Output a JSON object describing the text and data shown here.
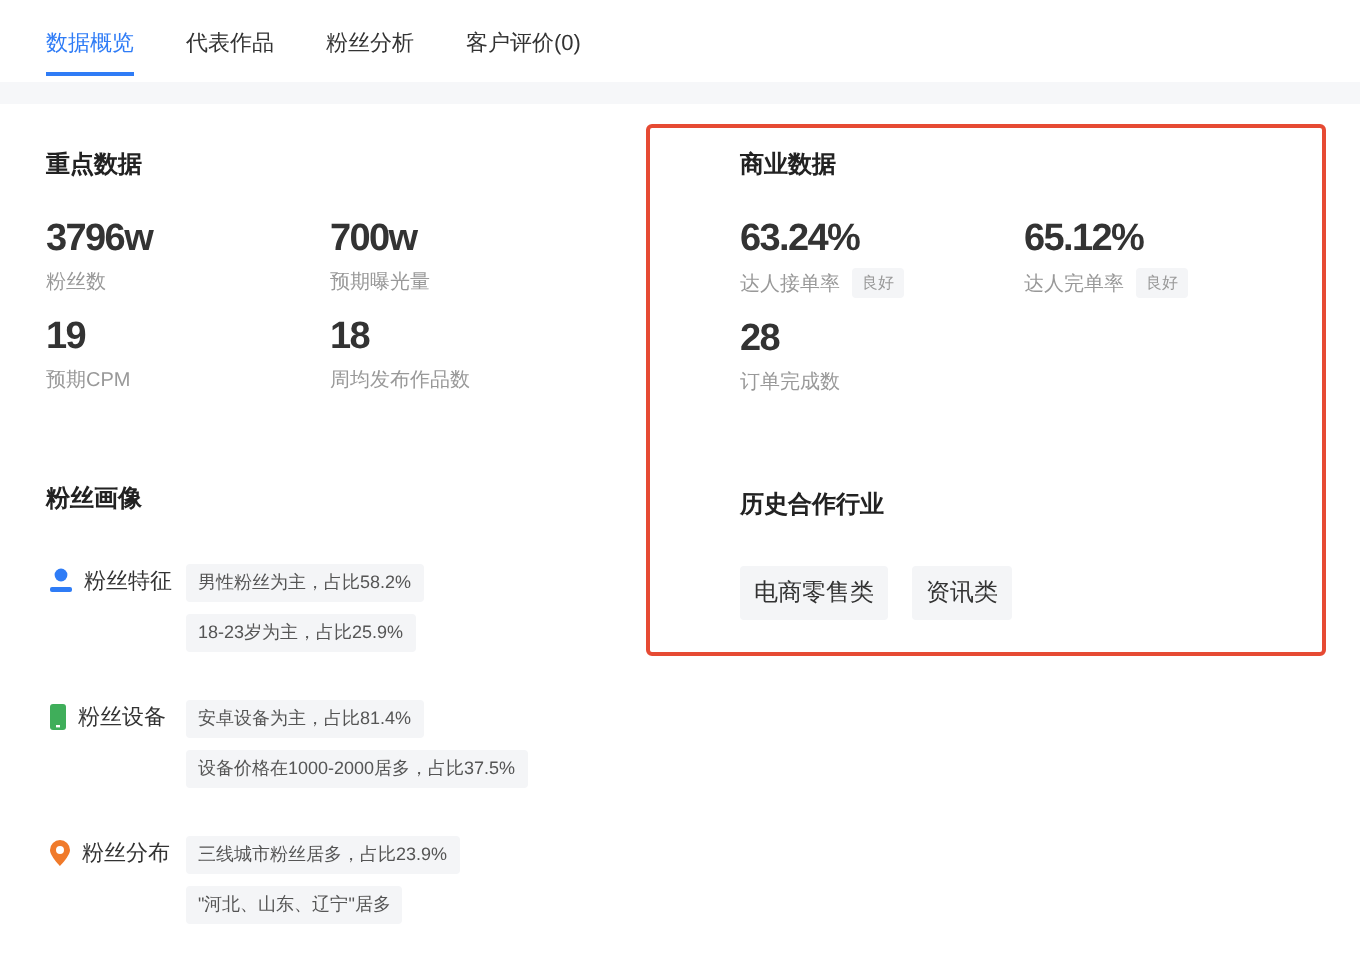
{
  "tabs": [
    {
      "label": "数据概览",
      "selected": true
    },
    {
      "label": "代表作品",
      "selected": false
    },
    {
      "label": "粉丝分析",
      "selected": false
    },
    {
      "label": "客户评价(0)",
      "selected": false
    }
  ],
  "key_data": {
    "title": "重点数据",
    "metrics": [
      {
        "value": "3796w",
        "label": "粉丝数"
      },
      {
        "value": "700w",
        "label": "预期曝光量"
      },
      {
        "value": "19",
        "label": "预期CPM"
      },
      {
        "value": "18",
        "label": "周均发布作品数"
      }
    ]
  },
  "fan_portrait": {
    "title": "粉丝画像",
    "groups": [
      {
        "kind": "person",
        "label": "粉丝特征",
        "tags": [
          "男性粉丝为主，占比58.2%",
          "18-23岁为主，占比25.9%"
        ]
      },
      {
        "kind": "phone",
        "label": "粉丝设备",
        "tags": [
          "安卓设备为主，占比81.4%",
          "设备价格在1000-2000居多，占比37.5%"
        ]
      },
      {
        "kind": "pin",
        "label": "粉丝分布",
        "tags": [
          "三线城市粉丝居多，占比23.9%",
          "\"河北、山东、辽宁\"居多"
        ]
      }
    ]
  },
  "business_data": {
    "title": "商业数据",
    "metrics": [
      {
        "value": "63.24%",
        "label": "达人接单率",
        "badge": "良好"
      },
      {
        "value": "65.12%",
        "label": "达人完单率",
        "badge": "良好"
      },
      {
        "value": "28",
        "label": "订单完成数"
      }
    ]
  },
  "industries": {
    "title": "历史合作行业",
    "tags": [
      "电商零售类",
      "资讯类"
    ]
  }
}
